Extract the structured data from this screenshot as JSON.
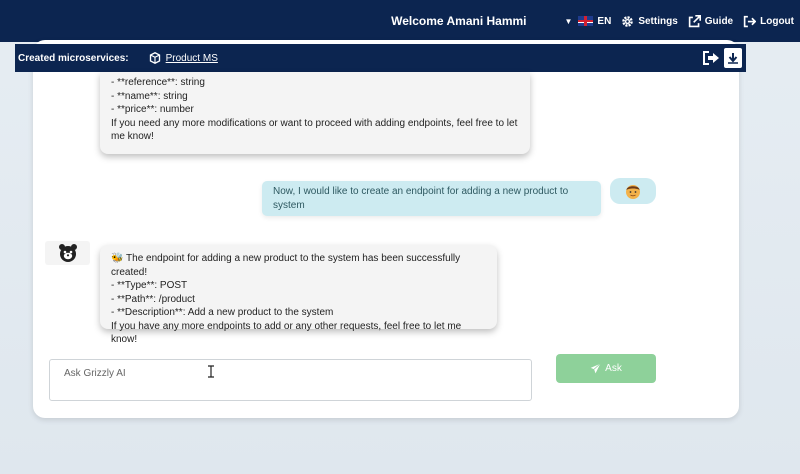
{
  "header": {
    "welcome": "Welcome Amani Hammi",
    "language": "EN",
    "settings": "Settings",
    "guide": "Guide",
    "logout": "Logout"
  },
  "microservices": {
    "label": "Created microservices:",
    "items": [
      {
        "name": "Product MS"
      }
    ]
  },
  "messages": [
    {
      "role": "assistant",
      "lines": [
        "- **reference**: string",
        "- **name**: string",
        "- **price**: number",
        "If you need any more modifications or want to proceed with adding endpoints, feel free to let me know!"
      ]
    },
    {
      "role": "user",
      "text": "Now, I would like to create an endpoint for adding a new product to system"
    },
    {
      "role": "assistant",
      "lines": [
        "🐝 The endpoint for adding a new product to the system has been successfully created!",
        "- **Type**: POST",
        "- **Path**: /product",
        "- **Description**: Add a new product to the system",
        "If you have any more endpoints to add or any other requests, feel free to let me know!"
      ]
    }
  ],
  "input": {
    "placeholder": "Ask Grizzly AI",
    "value": ""
  },
  "ask_button": "Ask",
  "colors": {
    "navbar": "#0c2550",
    "user_bubble": "#cdebf1",
    "bot_bubble": "#f4f4f4",
    "ask_button": "#8ed19a"
  }
}
